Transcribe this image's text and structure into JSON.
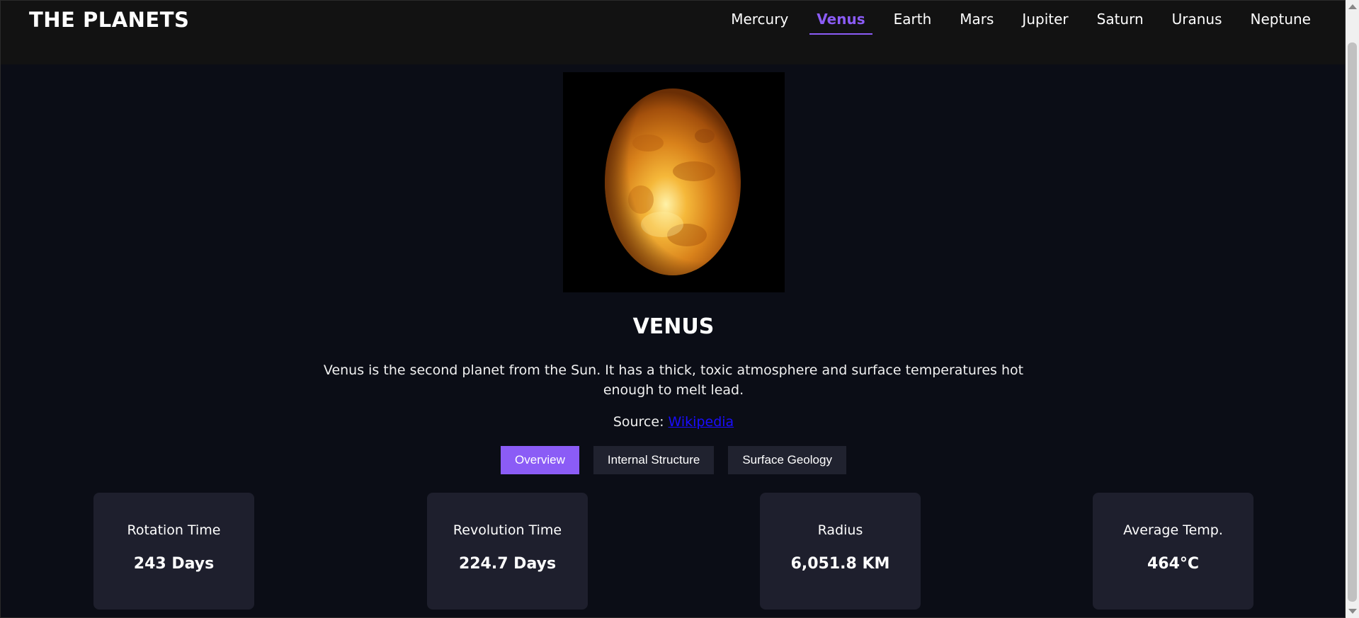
{
  "header": {
    "logo": "THE PLANETS",
    "nav": [
      {
        "label": "Mercury",
        "active": false
      },
      {
        "label": "Venus",
        "active": true
      },
      {
        "label": "Earth",
        "active": false
      },
      {
        "label": "Mars",
        "active": false
      },
      {
        "label": "Jupiter",
        "active": false
      },
      {
        "label": "Saturn",
        "active": false
      },
      {
        "label": "Uranus",
        "active": false
      },
      {
        "label": "Neptune",
        "active": false
      }
    ]
  },
  "planet": {
    "name": "VENUS",
    "description": "Venus is the second planet from the Sun. It has a thick, toxic atmosphere and surface temperatures hot enough to melt lead.",
    "source_prefix": "Source: ",
    "source_link": "Wikipedia"
  },
  "tabs": [
    {
      "label": "Overview",
      "active": true
    },
    {
      "label": "Internal Structure",
      "active": false
    },
    {
      "label": "Surface Geology",
      "active": false
    }
  ],
  "stats": [
    {
      "label": "Rotation Time",
      "value": "243 Days"
    },
    {
      "label": "Revolution Time",
      "value": "224.7 Days"
    },
    {
      "label": "Radius",
      "value": "6,051.8 KM"
    },
    {
      "label": "Average Temp.",
      "value": "464°C"
    }
  ],
  "colors": {
    "accent": "#8b5cf6",
    "background": "#0b0d16",
    "header": "#121212",
    "card": "#1e1f2d",
    "link": "#1a0dff"
  }
}
